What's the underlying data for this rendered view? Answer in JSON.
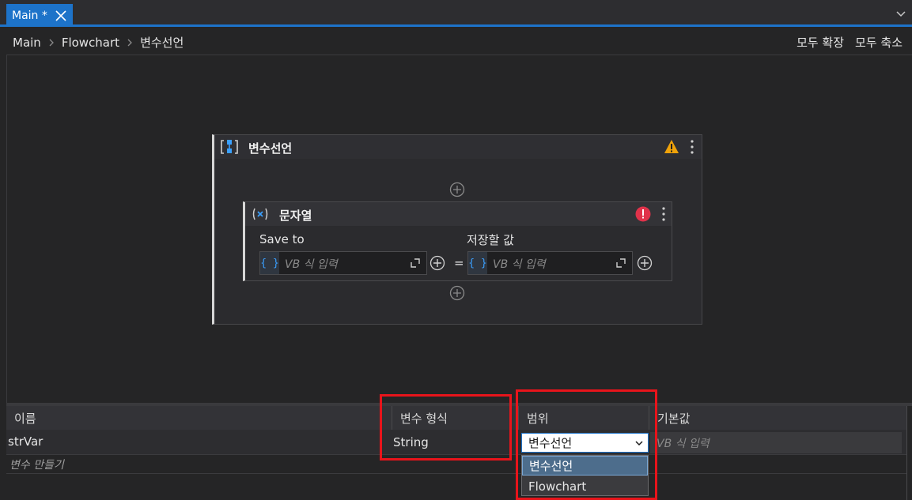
{
  "tab": {
    "title": "Main *"
  },
  "breadcrumb": {
    "items": [
      "Main",
      "Flowchart",
      "변수선언"
    ]
  },
  "actions": {
    "expand_all": "모두 확장",
    "collapse_all": "모두 축소"
  },
  "sequence": {
    "title": "변수선언"
  },
  "assign": {
    "title": "문자열",
    "save_to_label": "Save to",
    "value_label": "저장할 값",
    "placeholder": "VB 식 입력",
    "equals": "="
  },
  "variables": {
    "headers": {
      "name": "이름",
      "type": "변수 형식",
      "scope": "범위",
      "default": "기본값"
    },
    "row": {
      "name": "strVar",
      "type": "String",
      "scope": "변수선언",
      "default_placeholder": "VB 식 입력"
    },
    "create_label": "변수 만들기",
    "scope_options": [
      "변수선언",
      "Flowchart"
    ]
  },
  "colors": {
    "accent": "#1d73c9",
    "highlight": "#e8141b",
    "warning": "#f0a30a",
    "error": "#e0324a"
  }
}
